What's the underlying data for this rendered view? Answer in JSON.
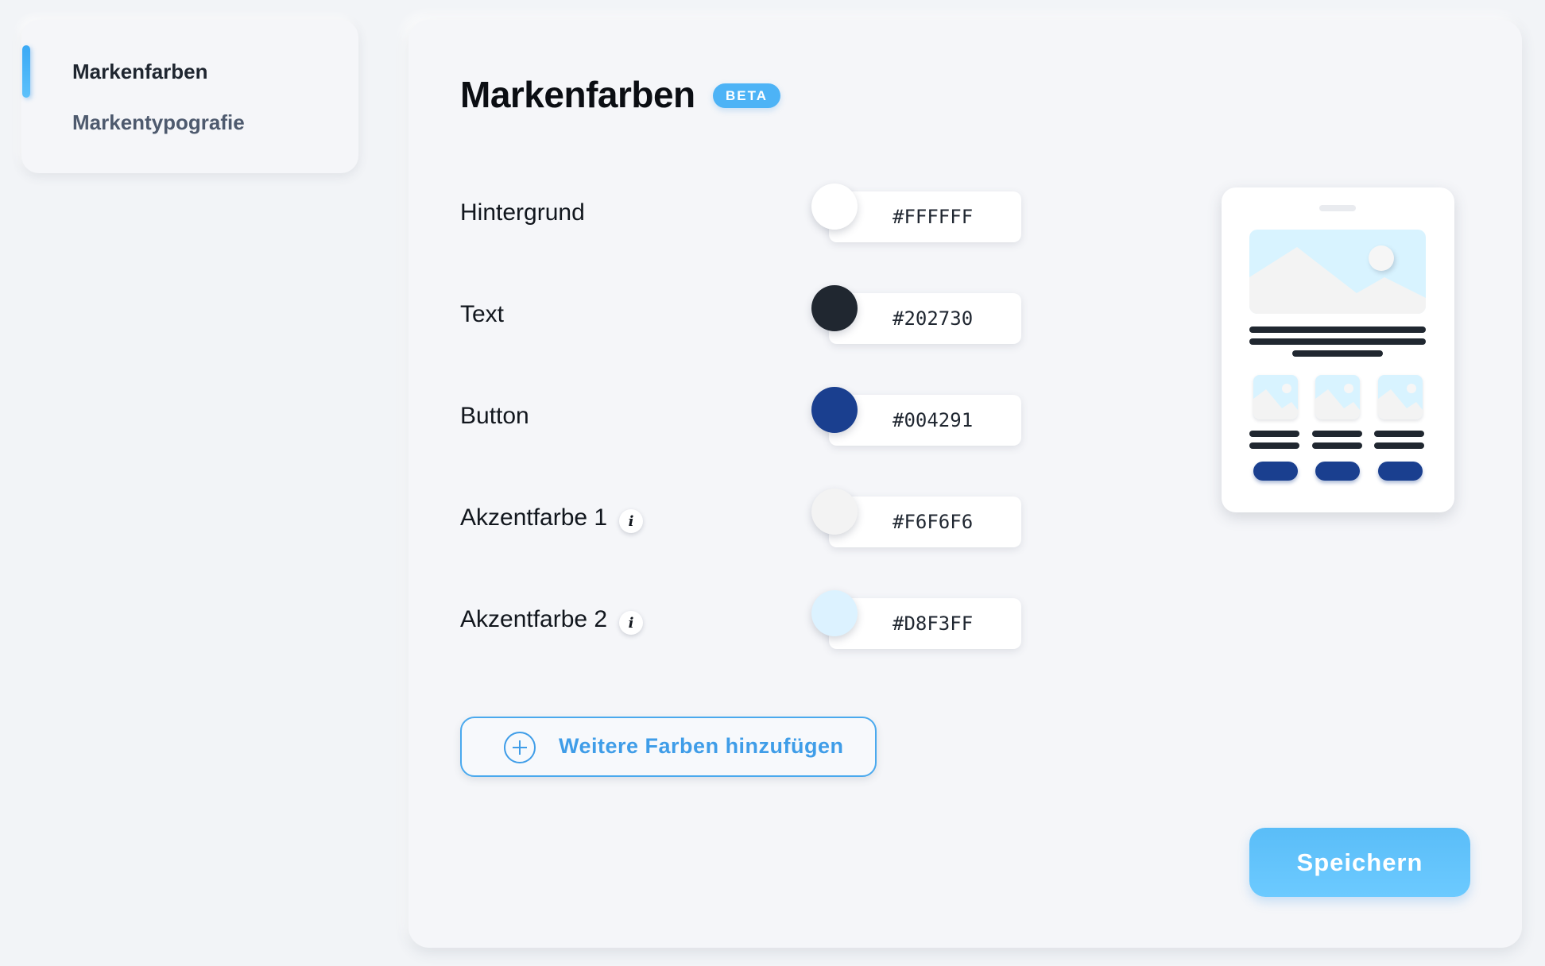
{
  "sidebar": {
    "items": [
      {
        "label": "Markenfarben",
        "active": true
      },
      {
        "label": "Markentypografie",
        "active": false
      }
    ]
  },
  "header": {
    "title": "Markenfarben",
    "badge": "BETA"
  },
  "colors": [
    {
      "label": "Hintergrund",
      "hex": "#FFFFFF",
      "swatch": "#FFFFFF",
      "info": false
    },
    {
      "label": "Text",
      "hex": "#202730",
      "swatch": "#202730",
      "info": false
    },
    {
      "label": "Button",
      "hex": "#004291",
      "swatch": "#1A3F8F",
      "info": false
    },
    {
      "label": "Akzentfarbe 1",
      "hex": "#F6F6F6",
      "swatch": "#F3F3F3",
      "info": true
    },
    {
      "label": "Akzentfarbe 2",
      "hex": "#D8F3FF",
      "swatch": "#DCF2FF",
      "info": true
    }
  ],
  "info_icon_glyph": "i",
  "actions": {
    "add_colors": "Weitere Farben hinzufügen",
    "save": "Speichern"
  },
  "theme": {
    "accent": "#4DB3F6",
    "text": "#202730",
    "button": "#1A3F8F",
    "accent1": "#F6F6F6",
    "accent2": "#D8F3FF"
  }
}
